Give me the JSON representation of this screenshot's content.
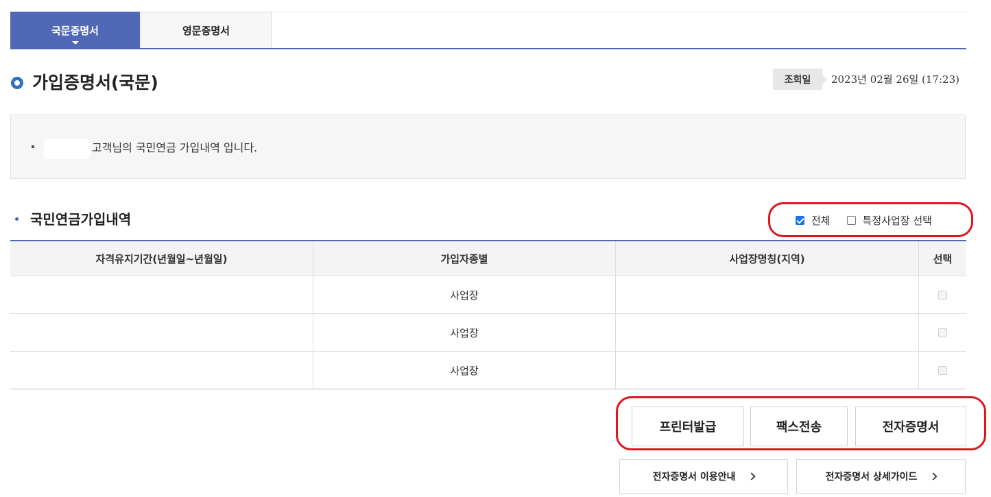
{
  "tabs": [
    {
      "label": "국문증명서",
      "active": true
    },
    {
      "label": "영문증명서",
      "active": false
    }
  ],
  "header": {
    "title": "가입증명서(국문)",
    "query_label": "조회일",
    "query_date": "2023년 02월 26일 (17:23)"
  },
  "info": {
    "text": "고객님의 국민연금 가입내역 입니다."
  },
  "section": {
    "title": "국민연금가입내역",
    "filter_all_label": "전체",
    "filter_all_checked": true,
    "filter_specific_label": "특정사업장 선택",
    "filter_specific_checked": false
  },
  "table": {
    "columns": [
      "자격유지기간(년월일~년월일)",
      "가입자종별",
      "사업장명칭(지역)",
      "선택"
    ],
    "rows": [
      {
        "period": "",
        "type": "사업장",
        "name": "",
        "selected": false
      },
      {
        "period": "",
        "type": "사업장",
        "name": "",
        "selected": false
      },
      {
        "period": "",
        "type": "사업장",
        "name": "",
        "selected": false
      }
    ]
  },
  "actions": {
    "print_label": "프린터발급",
    "fax_label": "팩스전송",
    "ecert_label": "전자증명서"
  },
  "links": {
    "usage_label": "전자증명서 이용안내",
    "guide_label": "전자증명서 상세가이드"
  },
  "colors": {
    "accent": "#5168b7",
    "title_icon": "#2f72c4",
    "highlight": "#e0141e",
    "checkbox": "#1a73e8"
  }
}
